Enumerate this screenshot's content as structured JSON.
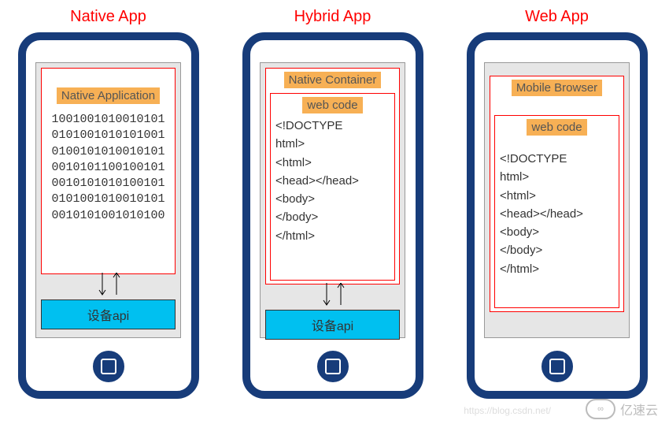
{
  "titles": {
    "native": "Native App",
    "hybrid": "Hybrid App",
    "web": "Web App"
  },
  "native": {
    "label": "Native Application",
    "binary": "1001001010010101\n0101001010101001\n0100101010010101\n0010101100100101\n0010101010100101\n0101001010010101\n0010101001010100",
    "api": "设备api"
  },
  "hybrid": {
    "container_label": "Native Container",
    "webcode_label": "web code",
    "code": "<!DOCTYPE\nhtml>\n<html>\n<head></head>\n<body>\n</body>\n</html>",
    "api": "设备api"
  },
  "web": {
    "browser_label": "Mobile Browser",
    "webcode_label": "web code",
    "code": "<!DOCTYPE\nhtml>\n<html>\n<head></head>\n<body>\n</body>\n</html>"
  },
  "watermark": {
    "url": "https://blog.csdn.net/",
    "brand": "亿速云"
  }
}
